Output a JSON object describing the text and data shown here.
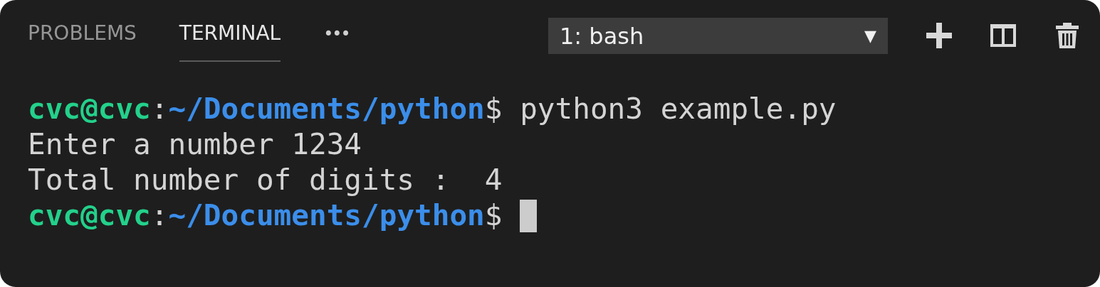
{
  "tabs": [
    {
      "label": "PROBLEMS",
      "selected": false
    },
    {
      "label": "TERMINAL",
      "selected": true
    }
  ],
  "more": "•••",
  "terminal_select": {
    "value": "1: bash",
    "caret": "▼"
  },
  "actions": [
    {
      "kind": "add"
    },
    {
      "kind": "split"
    },
    {
      "kind": "trash"
    }
  ],
  "lines": [
    [
      {
        "kind": "user",
        "text": "cvc@cvc"
      },
      {
        "kind": "plain",
        "text": ":"
      },
      {
        "kind": "path",
        "text": "~/Documents/python"
      },
      {
        "kind": "plain",
        "text": "$ python3 example.py"
      }
    ],
    [
      {
        "kind": "plain",
        "text": "Enter a number 1234"
      }
    ],
    [
      {
        "kind": "plain",
        "text": "Total number of digits :  4"
      }
    ],
    [
      {
        "kind": "user",
        "text": "cvc@cvc"
      },
      {
        "kind": "plain",
        "text": ":"
      },
      {
        "kind": "path",
        "text": "~/Documents/python"
      },
      {
        "kind": "plain",
        "text": "$ "
      },
      {
        "kind": "cursor"
      }
    ]
  ]
}
